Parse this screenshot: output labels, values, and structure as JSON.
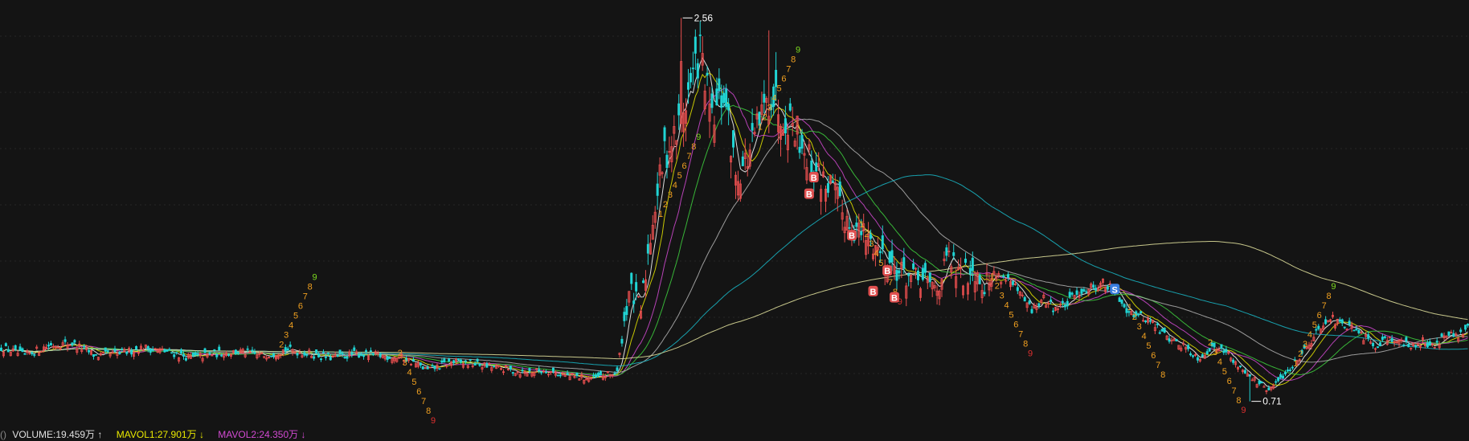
{
  "colors": {
    "background": "#141414",
    "up": "#e84f4f",
    "down": "#21d4d4",
    "ma5": "#ffffff",
    "ma10": "#e8e800",
    "ma20": "#d24ad2",
    "ma30": "#3ed13e",
    "ma60": "#b4b4b4",
    "ma120": "#19b8c8",
    "ma250": "#e6e6a0",
    "setup": "#f0a020",
    "nine": "#7ddc1f",
    "nine_low": "#e03030",
    "buy_badge": "#e05050",
    "sell_badge": "#3a7ee0"
  },
  "chart_data": {
    "type": "candlestick",
    "ylim": [
      0.6,
      2.6
    ],
    "price_path": [
      [
        0,
        0.97
      ],
      [
        10,
        0.93
      ],
      [
        20,
        0.98
      ],
      [
        30,
        0.99
      ],
      [
        40,
        0.93
      ],
      [
        50,
        0.94
      ],
      [
        60,
        0.97
      ],
      [
        70,
        0.95
      ],
      [
        80,
        0.92
      ],
      [
        90,
        0.94
      ],
      [
        100,
        0.95
      ],
      [
        110,
        0.93
      ],
      [
        120,
        0.96
      ],
      [
        130,
        0.94
      ],
      [
        140,
        0.92
      ],
      [
        150,
        0.94
      ],
      [
        160,
        0.93
      ],
      [
        170,
        0.92
      ],
      [
        180,
        0.86
      ],
      [
        190,
        0.9
      ],
      [
        200,
        0.89
      ],
      [
        210,
        0.87
      ],
      [
        220,
        0.85
      ],
      [
        230,
        0.86
      ],
      [
        240,
        0.83
      ],
      [
        250,
        0.82
      ],
      [
        260,
        0.85
      ],
      [
        265,
        1.25
      ],
      [
        270,
        1.15
      ],
      [
        275,
        1.6
      ],
      [
        280,
        1.9
      ],
      [
        285,
        2.0
      ],
      [
        290,
        2.2
      ],
      [
        295,
        2.4
      ],
      [
        300,
        2.05
      ],
      [
        305,
        2.2
      ],
      [
        310,
        1.8
      ],
      [
        315,
        1.88
      ],
      [
        320,
        2.05
      ],
      [
        325,
        2.2
      ],
      [
        330,
        2.1
      ],
      [
        335,
        2.05
      ],
      [
        340,
        1.9
      ],
      [
        345,
        1.8
      ],
      [
        350,
        1.75
      ],
      [
        355,
        1.62
      ],
      [
        360,
        1.55
      ],
      [
        365,
        1.5
      ],
      [
        370,
        1.45
      ],
      [
        375,
        1.38
      ],
      [
        380,
        1.33
      ],
      [
        385,
        1.3
      ],
      [
        390,
        1.28
      ],
      [
        395,
        1.26
      ],
      [
        400,
        1.4
      ],
      [
        405,
        1.3
      ],
      [
        410,
        1.36
      ],
      [
        415,
        1.28
      ],
      [
        420,
        1.32
      ],
      [
        425,
        1.3
      ],
      [
        430,
        1.22
      ],
      [
        435,
        1.15
      ],
      [
        440,
        1.2
      ],
      [
        445,
        1.16
      ],
      [
        450,
        1.18
      ],
      [
        455,
        1.24
      ],
      [
        460,
        1.26
      ],
      [
        465,
        1.28
      ],
      [
        470,
        1.24
      ],
      [
        475,
        1.16
      ],
      [
        480,
        1.12
      ],
      [
        485,
        1.1
      ],
      [
        490,
        1.04
      ],
      [
        495,
        1.0
      ],
      [
        500,
        0.97
      ],
      [
        505,
        0.92
      ],
      [
        510,
        0.96
      ],
      [
        515,
        0.98
      ],
      [
        520,
        0.9
      ],
      [
        525,
        0.86
      ],
      [
        530,
        0.8
      ],
      [
        535,
        0.76
      ],
      [
        540,
        0.82
      ],
      [
        545,
        0.88
      ],
      [
        550,
        0.96
      ],
      [
        555,
        1.04
      ],
      [
        560,
        1.12
      ],
      [
        565,
        1.08
      ],
      [
        570,
        1.06
      ],
      [
        575,
        1.02
      ],
      [
        580,
        0.98
      ],
      [
        585,
        1.02
      ],
      [
        590,
        1.0
      ],
      [
        595,
        0.97
      ],
      [
        600,
        1.0
      ],
      [
        605,
        0.98
      ],
      [
        610,
        1.03
      ],
      [
        615,
        1.02
      ],
      [
        619,
        1.06
      ]
    ],
    "extremes": [
      {
        "price": 2.56,
        "label": "2.56"
      },
      {
        "price": 0.71,
        "label": "0.71"
      }
    ],
    "moving_averages": [
      "ma5",
      "ma10",
      "ma20",
      "ma30",
      "ma60",
      "ma120",
      "ma250"
    ],
    "signals": {
      "setup_sequences": [
        {
          "anchor_index": 120,
          "anchor_price": 0.97,
          "labels": [
            "2",
            "3",
            "4",
            "5",
            "6",
            "7",
            "8",
            "9"
          ],
          "direction": "up"
        },
        {
          "anchor_index": 170,
          "anchor_price": 0.93,
          "labels": [
            "2",
            "3",
            "4",
            "5",
            "6",
            "7",
            "8",
            "9"
          ],
          "direction": "down"
        },
        {
          "anchor_index": 280,
          "anchor_price": 1.6,
          "labels": [
            "1",
            "2",
            "3",
            "4",
            "5",
            "6",
            "7",
            "8",
            "9"
          ],
          "direction": "up"
        },
        {
          "anchor_index": 322,
          "anchor_price": 2.02,
          "labels": [
            "1",
            "2",
            "3",
            "4",
            "5",
            "6",
            "7",
            "8",
            "9"
          ],
          "direction": "up"
        },
        {
          "anchor_index": 365,
          "anchor_price": 1.55,
          "labels": [
            "1",
            "2",
            "3",
            "4",
            "5",
            "6",
            "7",
            "8",
            "9"
          ],
          "direction": "down"
        },
        {
          "anchor_index": 420,
          "anchor_price": 1.3,
          "labels": [
            "1",
            "2",
            "3",
            "4",
            "5",
            "6",
            "7",
            "8",
            "9"
          ],
          "direction": "down"
        },
        {
          "anchor_index": 478,
          "anchor_price": 1.15,
          "labels": [
            "1",
            "2",
            "3",
            "4",
            "5",
            "6",
            "7",
            "8"
          ],
          "direction": "down"
        },
        {
          "anchor_index": 512,
          "anchor_price": 0.98,
          "labels": [
            "2",
            "3",
            "4",
            "5",
            "6",
            "7",
            "8",
            "9"
          ],
          "direction": "down"
        },
        {
          "anchor_index": 548,
          "anchor_price": 0.88,
          "labels": [
            "1",
            "2",
            "3",
            "4",
            "5",
            "6",
            "7",
            "8",
            "9"
          ],
          "direction": "up"
        }
      ],
      "buy_badges": [
        {
          "index": 343,
          "price": 1.79,
          "label": "B"
        },
        {
          "index": 341,
          "price": 1.71,
          "label": "B"
        },
        {
          "index": 359,
          "price": 1.51,
          "label": "B"
        },
        {
          "index": 374,
          "price": 1.34,
          "label": "B"
        },
        {
          "index": 368,
          "price": 1.24,
          "label": "B"
        },
        {
          "index": 377,
          "price": 1.21,
          "label": "B"
        }
      ],
      "sell_badges": [
        {
          "index": 470,
          "price": 1.25,
          "label": "S"
        }
      ]
    }
  },
  "volume_bar": {
    "prefix": "()",
    "volume": "VOLUME:19.459万",
    "volume_arrow": "↑",
    "mavol1": "MAVOL1:27.901万",
    "mavol1_arrow": "↓",
    "mavol2": "MAVOL2:24.350万",
    "mavol2_arrow": "↓"
  }
}
